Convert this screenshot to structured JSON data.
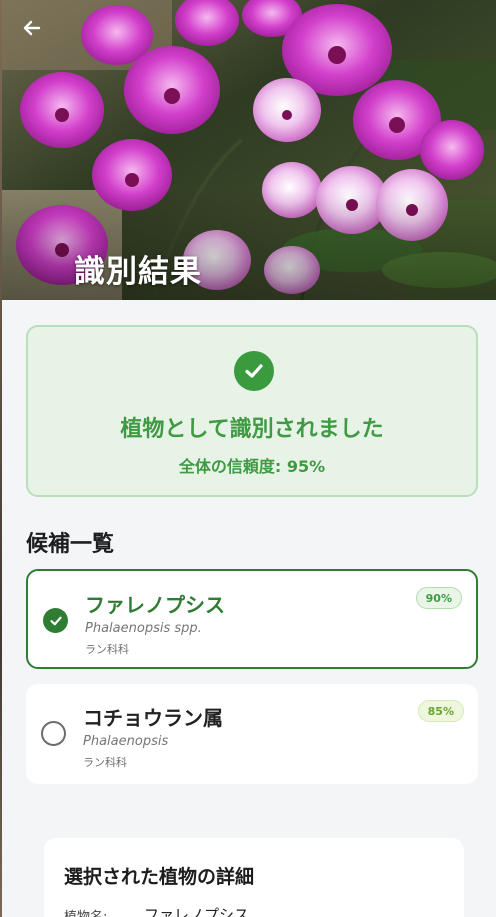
{
  "header": {
    "title": "識別結果",
    "back_icon": "arrow-left-icon"
  },
  "result": {
    "title": "植物として識別されました",
    "confidence_text": "全体の信頼度: 95%",
    "status_icon": "check-circle-icon",
    "status_color": "#3a9a3e"
  },
  "candidates": {
    "section_title": "候補一覧",
    "items": [
      {
        "name": "ファレノプシス",
        "scientific": "Phalaenopsis spp.",
        "family": "ラン科科",
        "score": "90%",
        "selected": true
      },
      {
        "name": "コチョウラン属",
        "scientific": "Phalaenopsis",
        "family": "ラン科科",
        "score": "85%",
        "selected": false
      }
    ]
  },
  "details": {
    "title": "選択された植物の詳細",
    "name_label": "植物名:",
    "name_value": "ファレノプシス"
  },
  "colors": {
    "accent_green": "#2f7d33",
    "success_bg": "#e8f3e7",
    "success_text": "#3f9a43"
  }
}
